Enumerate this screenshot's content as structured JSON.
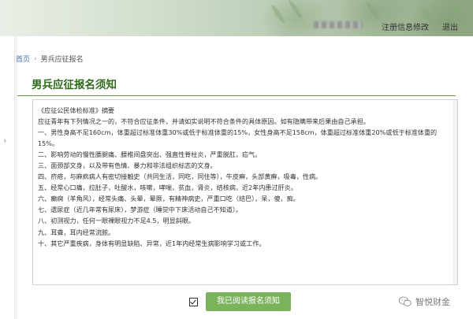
{
  "header": {
    "register_modify_label": "注册信息修改",
    "logout_label": "退出"
  },
  "breadcrumb": {
    "home": "首页",
    "separator": "›",
    "current": "男兵应征报名"
  },
  "page_title": "男兵应征报名须知",
  "notice": {
    "lines": [
      "《应征公民体检标准》摘要",
      "应征青年有下列情况之一的，不符合应征条件，并请如实说明不符合条件的具体原因。如有隐瞒带来后果由自己承担。",
      "一、男性身高不足160cm，体重超过标准体重30%或低于标准体重的15%，女性身高不足158cm，体重超过标准体重20%或低于标准体重的15%。",
      "二、影响劳动的慢性腰腿痛、腰椎间盘突出、强直性脊柱炎，严重脱肛，疝气。",
      "三、面颈部文身，以及带有色情、暴力和非法组织标志的文身。",
      "四、疥疮，与麻疯病人有密切接触史（共同生活，同吃，同住等），牛皮癣，头部黄癣，吸毒，性病。",
      "五、经常心口痛，拉肚子，吐酸水，咳嗽，哮喘，贫血，肾炎，结核病，近2年内患过肝炎。",
      "六、癫痫（羊角风），经常头痛、头晕，晕厥，有精神病史，严重口吃（结巴），呆，傻，痴。",
      "七、遗尿症（近几年常有尿床），梦游症（睡觉中下床活动自己不知道）。",
      "八、初测视力，任何一眼裸眼视力不足4.5，明显斜眼。",
      "九、耳聋，耳内经常流脓。",
      "十、其它严重疾病，身体有明显缺陷、异常，近1年内经常生病影响学习或工作。"
    ]
  },
  "footer": {
    "accept_label": "我已阅读报名须知",
    "checked": true
  },
  "watermark": {
    "text": "智悦财金"
  },
  "colors": {
    "title_green": "#2d6b1a",
    "button_green": "#7bb25c",
    "link_blue": "#4a6fa5"
  }
}
